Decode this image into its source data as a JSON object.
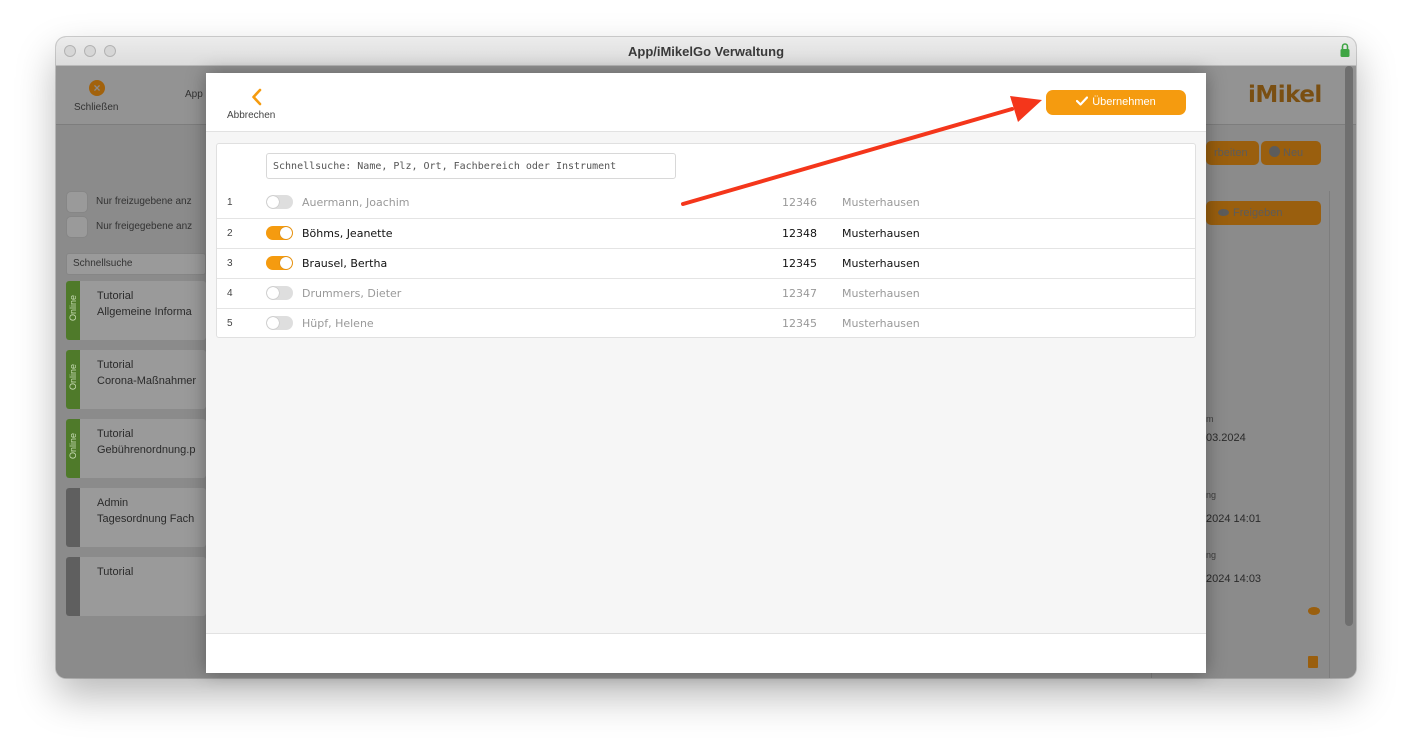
{
  "window": {
    "title": "App/iMikelGo Verwaltung"
  },
  "background": {
    "close_label": "Schließen",
    "app_label": "App",
    "logo": "iMikel",
    "btn_edit": "rbeiten",
    "btn_new": "Neu",
    "btn_release": "Freigeben",
    "filter_1": "Nur freizugebene anz",
    "filter_2": "Nur freigegebene anz",
    "search_placeholder": "Schnellsuche",
    "cards": [
      {
        "tag": "Online",
        "line1": "Tutorial",
        "line2": "Allgemeine Informa"
      },
      {
        "tag": "Online",
        "line1": "Tutorial",
        "line2": "Corona-Maßnahmer"
      },
      {
        "tag": "Online",
        "line1": "Tutorial",
        "line2": "Gebührenordnung.p"
      },
      {
        "tag": "",
        "line1": "Admin",
        "line2": "Tagesordnung Fach"
      },
      {
        "tag": "",
        "line1": "Tutorial",
        "line2": ""
      }
    ],
    "right": {
      "label_a": "m",
      "date_a": "03.2024",
      "label_b": "ng",
      "date_b": "2024 14:01",
      "label_c": "ng",
      "date_c": "2024 14:03"
    }
  },
  "modal": {
    "back_label": "Abbrechen",
    "accept_label": "Übernehmen",
    "search_placeholder": "Schnellsuche: Name, Plz, Ort, Fachbereich oder Instrument",
    "rows": [
      {
        "num": "1",
        "name": "Auermann, Joachim",
        "plz": "12346",
        "ort": "Musterhausen",
        "selected": false
      },
      {
        "num": "2",
        "name": "Böhms, Jeanette",
        "plz": "12348",
        "ort": "Musterhausen",
        "selected": true
      },
      {
        "num": "3",
        "name": "Brausel, Bertha",
        "plz": "12345",
        "ort": "Musterhausen",
        "selected": true
      },
      {
        "num": "4",
        "name": "Drummers, Dieter",
        "plz": "12347",
        "ort": "Musterhausen",
        "selected": false
      },
      {
        "num": "5",
        "name": "Hüpf, Helene",
        "plz": "12345",
        "ort": "Musterhausen",
        "selected": false
      }
    ]
  },
  "colors": {
    "accent": "#f59b0f",
    "online_tag": "#4f7a2a",
    "offline_tag": "#5f5f5f",
    "annotation_arrow": "#f4361b"
  }
}
